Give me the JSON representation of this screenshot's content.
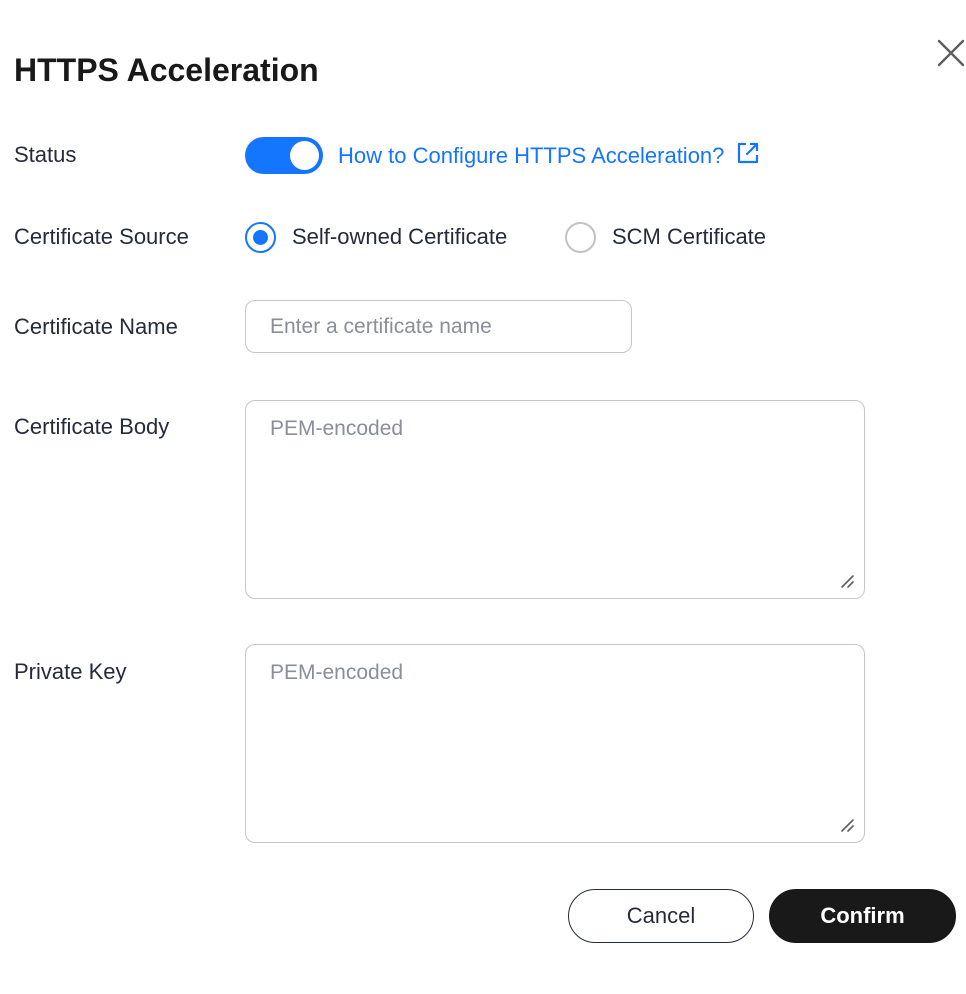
{
  "dialog": {
    "title": "HTTPS Acceleration",
    "close_icon": "close-icon"
  },
  "status": {
    "label": "Status",
    "enabled": true,
    "toggle_color": "#1476ff",
    "help_link": "How to Configure HTTPS Acceleration?",
    "help_link_icon": "external-link-icon"
  },
  "certificate_source": {
    "label": "Certificate Source",
    "options": [
      {
        "label": "Self-owned Certificate",
        "selected": true
      },
      {
        "label": "SCM Certificate",
        "selected": false
      }
    ]
  },
  "certificate_name": {
    "label": "Certificate Name",
    "value": "",
    "placeholder": "Enter a certificate name"
  },
  "certificate_body": {
    "label": "Certificate Body",
    "value": "",
    "placeholder": "PEM-encoded"
  },
  "private_key": {
    "label": "Private Key",
    "value": "",
    "placeholder": "PEM-encoded"
  },
  "footer": {
    "cancel_label": "Cancel",
    "confirm_label": "Confirm"
  },
  "colors": {
    "accent": "#1476ff",
    "primary_button": "#191919",
    "text": "#252b3a"
  }
}
